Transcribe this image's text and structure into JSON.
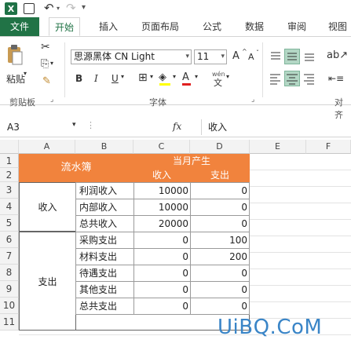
{
  "quick_access": {
    "logo": "X",
    "undo_icon": "↶",
    "redo_icon": "↷"
  },
  "tabs": [
    {
      "label": "文件"
    },
    {
      "label": "开始"
    },
    {
      "label": "插入"
    },
    {
      "label": "页面布局"
    },
    {
      "label": "公式"
    },
    {
      "label": "数据"
    },
    {
      "label": "审阅"
    },
    {
      "label": "视图"
    }
  ],
  "ribbon": {
    "paste_label": "粘贴",
    "font_name": "思源黑体 CN Light",
    "font_size": "11",
    "grow_font": "A",
    "shrink_font": "A",
    "bold": "B",
    "italic": "I",
    "underline": "U",
    "font_color": "A",
    "phonetic": "wén",
    "groups": {
      "clipboard": "剪贴板",
      "font": "字体",
      "alignment": "对齐"
    }
  },
  "formula_bar": {
    "name_box": "A3",
    "fx": "fx",
    "content": "收入"
  },
  "columns": [
    "A",
    "B",
    "C",
    "D",
    "E",
    "F"
  ],
  "rows": [
    "1",
    "2",
    "3",
    "4",
    "5",
    "6",
    "7",
    "8",
    "9",
    "10",
    "11"
  ],
  "sheet": {
    "header_title": "流水簿",
    "header_month": "当月产生",
    "header_income": "收入",
    "header_expense": "支出",
    "group_income": "收入",
    "group_expense": "支出",
    "items": [
      {
        "name": "利润收入",
        "income": "10000",
        "expense": "0"
      },
      {
        "name": "内部收入",
        "income": "10000",
        "expense": "0"
      },
      {
        "name": "总共收入",
        "income": "20000",
        "expense": "0"
      },
      {
        "name": "采购支出",
        "income": "0",
        "expense": "100"
      },
      {
        "name": "材料支出",
        "income": "0",
        "expense": "200"
      },
      {
        "name": "待遇支出",
        "income": "0",
        "expense": "0"
      },
      {
        "name": "其他支出",
        "income": "0",
        "expense": "0"
      },
      {
        "name": "总共支出",
        "income": "0",
        "expense": "0"
      }
    ]
  },
  "watermark": "UiBQ.CoM",
  "colors": {
    "accent_green": "#217346",
    "header_orange": "#f1833d",
    "watermark_blue": "#3a85c7"
  }
}
